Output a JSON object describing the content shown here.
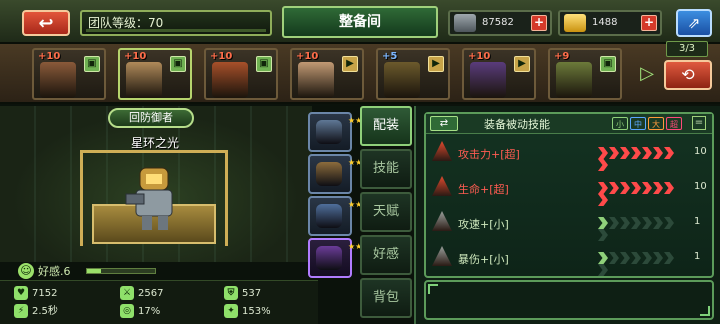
{
  "header": {
    "back_icon": "back-arrow-icon",
    "back_glyph": "↩",
    "team_level_label": "团队等级：70",
    "title": "整备间",
    "currency": [
      {
        "icon": "silver-ingot-icon",
        "value": "87582"
      },
      {
        "icon": "gold-ingot-icon",
        "value": "1488"
      }
    ],
    "plus_glyph": "+",
    "share_icon": "share-icon",
    "share_glyph": "⇗"
  },
  "roster": {
    "heroes": [
      {
        "level": "+10",
        "tag": "▣"
      },
      {
        "level": "+10",
        "tag": "▣",
        "selected": true
      },
      {
        "level": "+10",
        "tag": "▣"
      },
      {
        "level": "+10",
        "tag": "▶"
      },
      {
        "level": "+5",
        "tag": "▶"
      },
      {
        "level": "+10",
        "tag": "▶"
      },
      {
        "level": "+9",
        "tag": "▣"
      }
    ],
    "arrow_glyph": "▷",
    "team_count": "3/3",
    "team_swap_glyph": "⟲"
  },
  "scene": {
    "hero_class": "回防御者",
    "hero_name": "星环之光",
    "favor_label": "好感.6",
    "favor_progress": 0.2,
    "favor_icon_glyph": "☺"
  },
  "stats": [
    {
      "icon": "heart-icon",
      "glyph": "♥",
      "color": "#8fe06a",
      "value": "7152"
    },
    {
      "icon": "attack-icon",
      "glyph": "⚔",
      "color": "#8fe06a",
      "value": "2567"
    },
    {
      "icon": "armor-icon",
      "glyph": "⛨",
      "color": "#8fe06a",
      "value": "537"
    },
    {
      "icon": "speed-icon",
      "glyph": "⚡",
      "color": "#8fe06a",
      "value": "2.5秒"
    },
    {
      "icon": "crit-icon",
      "glyph": "◎",
      "color": "#8fe06a",
      "value": "17%"
    },
    {
      "icon": "crit-damage-icon",
      "glyph": "✦",
      "color": "#8fe06a",
      "value": "153%"
    }
  ],
  "item_slots": [
    {
      "gem_color": "#5f7896",
      "selected": false
    },
    {
      "gem_color": "#8c6c3c",
      "selected": false
    },
    {
      "gem_color": "#4f6f9c",
      "selected": false
    },
    {
      "gem_color": "#6b3c99",
      "selected": true
    }
  ],
  "tabs": [
    {
      "label": "配装",
      "active": true
    },
    {
      "label": "技能",
      "active": false
    },
    {
      "label": "天赋",
      "active": false
    },
    {
      "label": "好感",
      "active": false
    },
    {
      "label": "背包",
      "active": false
    }
  ],
  "skills_panel": {
    "swap_glyph": "⇄",
    "title": "装备被动技能",
    "sizes": [
      {
        "label": "小",
        "color": "#8fd07a"
      },
      {
        "label": "中",
        "color": "#5aa7ff"
      },
      {
        "label": "大",
        "color": "#ff9a3c"
      },
      {
        "label": "超",
        "color": "#ff4a7a"
      }
    ],
    "eq_glyph": "=",
    "rows": [
      {
        "name": "攻击力+[超]",
        "name_color": "#ff5c52",
        "icon_color": "#e04a2e",
        "value": "10",
        "filled": 8,
        "fill_color": "#ff4a4a"
      },
      {
        "name": "生命+[超]",
        "name_color": "#ff5c52",
        "icon_color": "#e04a2e",
        "value": "10",
        "filled": 8,
        "fill_color": "#ff4a4a"
      },
      {
        "name": "攻速+[小]",
        "name_color": "#cfe8bd",
        "icon_color": "#9aa09c",
        "value": "1",
        "filled": 1,
        "fill_color": "#8fd07a"
      },
      {
        "name": "暴伤+[小]",
        "name_color": "#cfe8bd",
        "icon_color": "#9aa09c",
        "value": "1",
        "filled": 1,
        "fill_color": "#8fd07a"
      }
    ],
    "total_chevrons": 8,
    "empty_chevron_color": "#2c4a3a"
  }
}
